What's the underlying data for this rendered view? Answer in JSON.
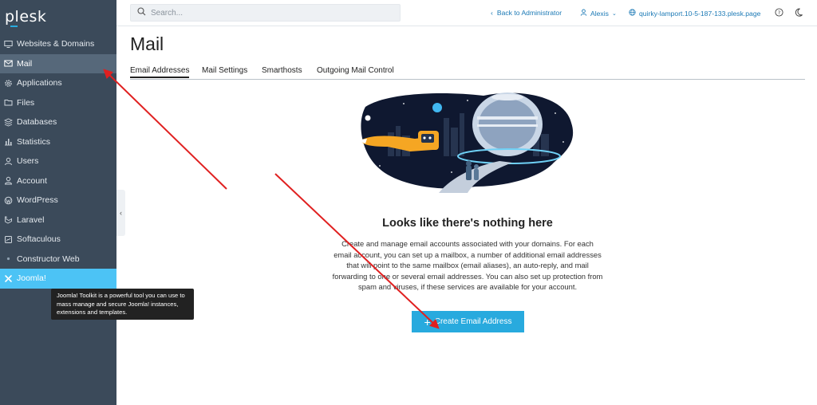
{
  "brand": {
    "logo_text": "plesk"
  },
  "search": {
    "placeholder": "Search..."
  },
  "topbar": {
    "back_label": "Back to Administrator",
    "user_label": "Alexis",
    "domain_label": "quirky-lamport.10-5-187-133.plesk.page"
  },
  "sidebar": {
    "items": [
      {
        "label": "Websites & Domains",
        "icon": "monitor-icon"
      },
      {
        "label": "Mail",
        "icon": "mail-icon"
      },
      {
        "label": "Applications",
        "icon": "gear-icon"
      },
      {
        "label": "Files",
        "icon": "folder-icon"
      },
      {
        "label": "Databases",
        "icon": "database-icon"
      },
      {
        "label": "Statistics",
        "icon": "chart-icon"
      },
      {
        "label": "Users",
        "icon": "user-icon"
      },
      {
        "label": "Account",
        "icon": "account-icon"
      },
      {
        "label": "WordPress",
        "icon": "wordpress-icon"
      },
      {
        "label": "Laravel",
        "icon": "laravel-icon"
      },
      {
        "label": "Softaculous",
        "icon": "softaculous-icon"
      },
      {
        "label": "Constructor Web",
        "icon": "constructor-icon"
      },
      {
        "label": "Joomla!",
        "icon": "joomla-icon"
      }
    ],
    "active_index": 1,
    "hover_index": 12
  },
  "tooltip": {
    "text": "Joomla! Toolkit is a powerful tool you can use to mass manage and secure Joomla! instances, extensions and templates."
  },
  "page": {
    "title": "Mail"
  },
  "tabs": [
    {
      "label": "Email Addresses",
      "active": true
    },
    {
      "label": "Mail Settings",
      "active": false
    },
    {
      "label": "Smarthosts",
      "active": false
    },
    {
      "label": "Outgoing Mail Control",
      "active": false
    }
  ],
  "empty_state": {
    "title": "Looks like there's nothing here",
    "description": "Create and manage email accounts associated with your domains. For each email account, you can set up a mailbox, a number of additional email addresses that will point to the same mailbox (email aliases), an auto-reply, and mail forwarding to one or several email addresses. You can also set up protection from spam and viruses, if these services are available for your account.",
    "button_label": "Create Email Address"
  },
  "colors": {
    "sidebar_bg": "#3b4a5a",
    "accent": "#28aade",
    "link": "#1b79b5",
    "annotation_arrow": "#e02020"
  }
}
